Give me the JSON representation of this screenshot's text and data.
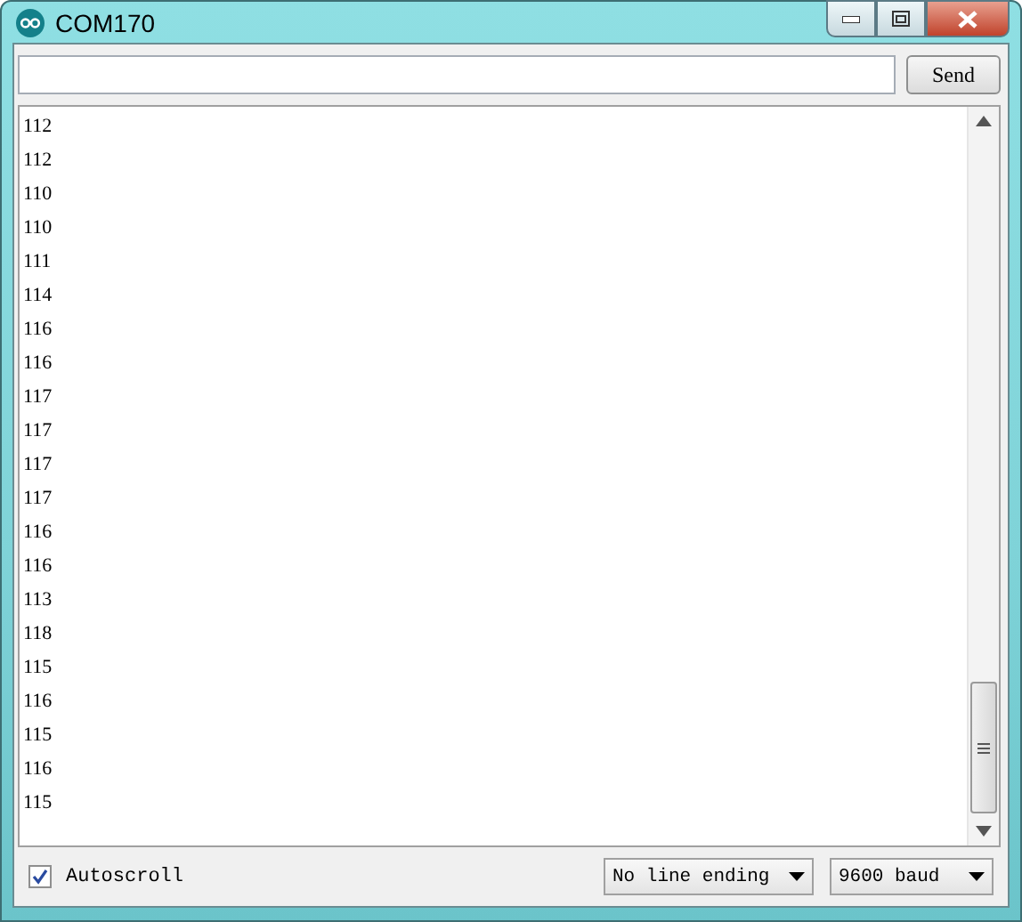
{
  "window": {
    "title": "COM170"
  },
  "send_button": "Send",
  "output_lines": [
    "112",
    "112",
    "110",
    "110",
    "111",
    "114",
    "116",
    "116",
    "117",
    "117",
    "117",
    "117",
    "116",
    "116",
    "113",
    "118",
    "115",
    "116",
    "115",
    "116",
    "115"
  ],
  "autoscroll": {
    "label": "Autoscroll",
    "checked": true
  },
  "line_ending": "No line ending",
  "baud": "9600 baud"
}
